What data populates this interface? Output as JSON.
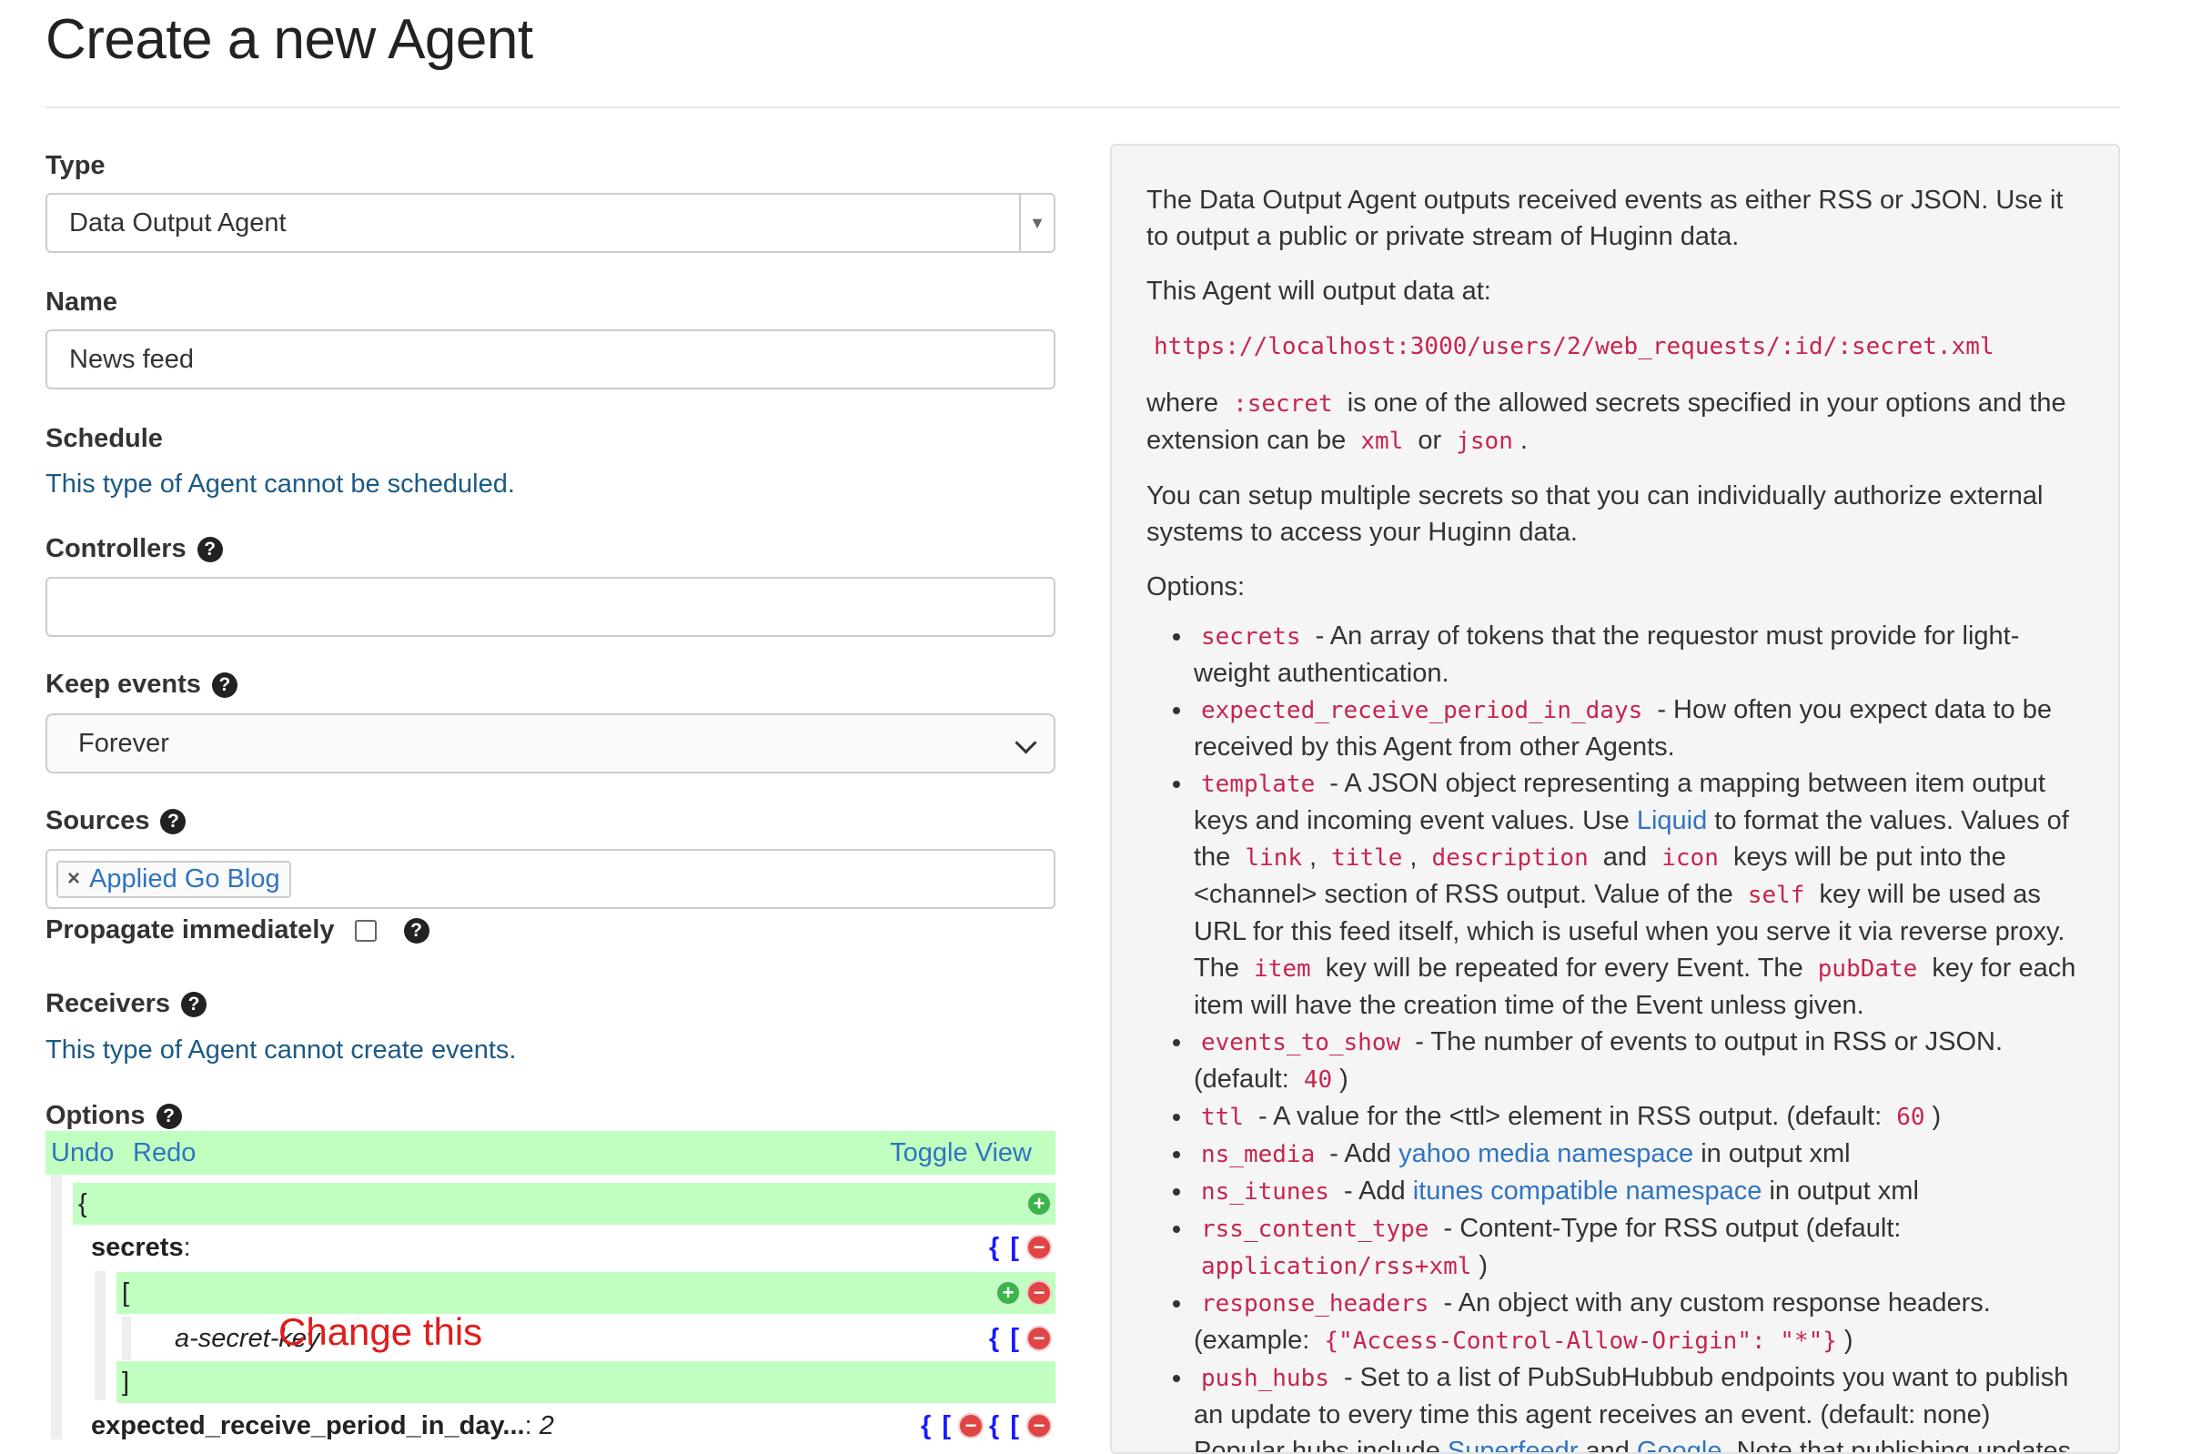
{
  "page": {
    "title": "Create a new Agent"
  },
  "form": {
    "type_label": "Type",
    "type_value": "Data Output Agent",
    "name_label": "Name",
    "name_value": "News feed",
    "schedule_label": "Schedule",
    "schedule_text": "This type of Agent cannot be scheduled.",
    "controllers_label": "Controllers",
    "controllers_value": "",
    "keep_events_label": "Keep events",
    "keep_events_value": "Forever",
    "sources_label": "Sources",
    "sources": [
      "Applied Go Blog"
    ],
    "propagate_label": "Propagate immediately",
    "receivers_label": "Receivers",
    "receivers_text": "This type of Agent cannot create events.",
    "options_label": "Options"
  },
  "editor": {
    "undo": "Undo",
    "redo": "Redo",
    "toggle_view": "Toggle View",
    "open_brace": "{",
    "open_bracket": "[",
    "close_bracket": "]",
    "type_symbol": "{ [",
    "key_secrets": "secrets",
    "secret_value": "a-secret-key",
    "key_period": "expected_receive_period_in_day...",
    "period_value": "2",
    "annotation": "Change this"
  },
  "description": {
    "intro": "The Data Output Agent outputs received events as either RSS or JSON. Use it to output a public or private stream of Huginn data.",
    "output_at": "This Agent will output data at:",
    "url": "https://localhost:3000/users/2/web_requests/:id/:secret.xml",
    "where": "where",
    "secret_code": ":secret",
    "where_rest": "is one of the allowed secrets specified in your options and the extension can be",
    "xml": "xml",
    "or": "or",
    "json": "json",
    "period": ".",
    "multi_secrets": "You can setup multiple secrets so that you can individually authorize external systems to access your Huginn data.",
    "options_heading": "Options:",
    "opt_secrets_code": "secrets",
    "opt_secrets_text": "- An array of tokens that the requestor must provide for light-weight authentication.",
    "opt_period_code": "expected_receive_period_in_days",
    "opt_period_text": "- How often you expect data to be received by this Agent from other Agents.",
    "opt_template_code": "template",
    "opt_template_t1": "- A JSON object representing a mapping between item output keys and incoming event values. Use",
    "opt_template_liquid": "Liquid",
    "opt_template_t2": "to format the values. Values of the",
    "code_link": "link",
    "comma": ",",
    "code_title": "title",
    "code_description": "description",
    "and": "and",
    "code_icon": "icon",
    "opt_template_t3": "keys will be put into the <channel> section of RSS output. Value of the",
    "code_self": "self",
    "opt_template_t4": "key will be used as URL for this feed itself, which is useful when you serve it via reverse proxy. The",
    "code_item": "item",
    "opt_template_t5": "key will be repeated for every Event. The",
    "code_pubdate": "pubDate",
    "opt_template_t6": "key for each item will have the creation time of the Event unless given.",
    "opt_events_code": "events_to_show",
    "opt_events_text": "- The number of events to output in RSS or JSON. (default:",
    "opt_events_default": "40",
    "close_paren": ")",
    "opt_ttl_code": "ttl",
    "opt_ttl_text": "- A value for the <ttl> element in RSS output. (default:",
    "opt_ttl_default": "60",
    "opt_media_code": "ns_media",
    "opt_add": "- Add",
    "opt_media_link": "yahoo media namespace",
    "opt_in_output": "in output xml",
    "opt_itunes_code": "ns_itunes",
    "opt_itunes_link": "itunes compatible namespace",
    "opt_rss_code": "rss_content_type",
    "opt_rss_text": "- Content-Type for RSS output (default:",
    "opt_rss_default": "application/rss+xml",
    "opt_headers_code": "response_headers",
    "opt_headers_text": "- An object with any custom response headers. (example:",
    "opt_headers_example": "{\"Access-Control-Allow-Origin\": \"*\"}",
    "opt_hubs_code": "push_hubs",
    "opt_hubs_text": "- Set to a list of PubSubHubbub endpoints you want to publish an update to every time this agent receives an event. (default: none)",
    "opt_hubs_text2": "Popular hubs include",
    "opt_hubs_superfeedr": "Superfeedr",
    "opt_hubs_google": "Google",
    "opt_hubs_text3": ". Note that publishing updates"
  },
  "colors": {
    "editor_green": "#c0ffc0",
    "link_blue": "#2f74c0",
    "help_text": "#1c5a85",
    "code_red": "#c7254e",
    "annotation_red": "#e01b1b"
  }
}
